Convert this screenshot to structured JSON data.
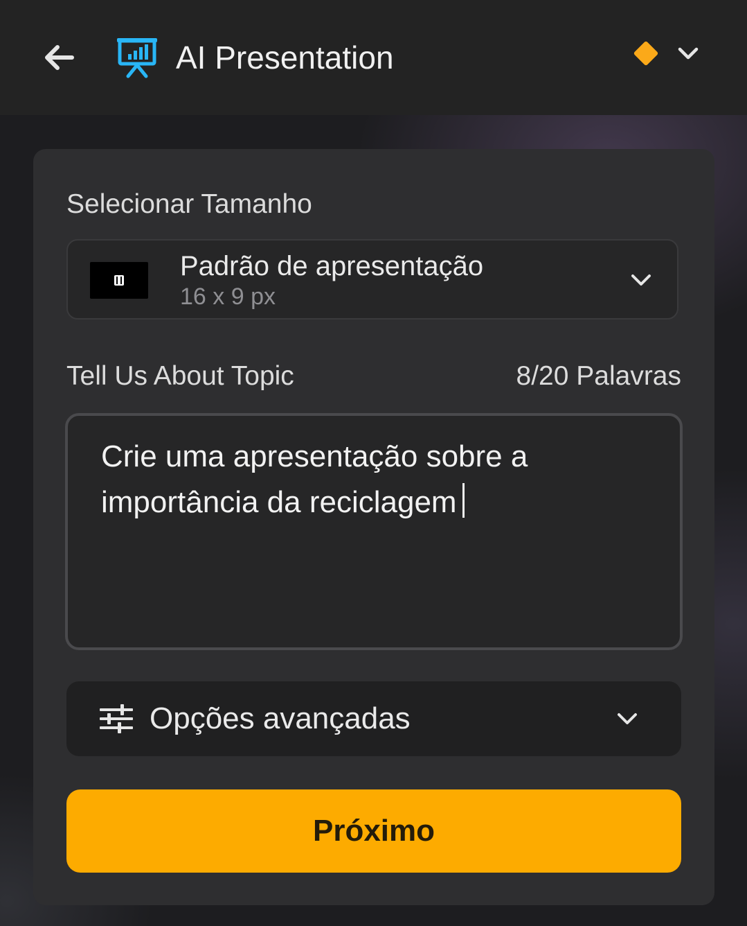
{
  "header": {
    "title": "AI Presentation",
    "back_icon": "arrow-left-icon",
    "app_icon": "presentation-board-icon",
    "premium_icon": "diamond-icon",
    "menu_icon": "chevron-down-icon"
  },
  "size_section": {
    "label": "Selecionar Tamanho",
    "selected": {
      "name": "Padrão de apresentação",
      "dimensions": "16 x 9 px"
    }
  },
  "topic_section": {
    "label": "Tell Us About Topic",
    "word_count": "8/20 Palavras",
    "value": "Crie uma apresentação sobre a importância da reciclagem"
  },
  "advanced": {
    "label": "Opções avançadas",
    "icon": "sliders-icon"
  },
  "next_button": {
    "label": "Próximo"
  },
  "colors": {
    "accent": "#fdab00",
    "premium": "#fba919",
    "icon_blue": "#29b6f6",
    "card": "#2e2e30",
    "header": "#232323"
  }
}
